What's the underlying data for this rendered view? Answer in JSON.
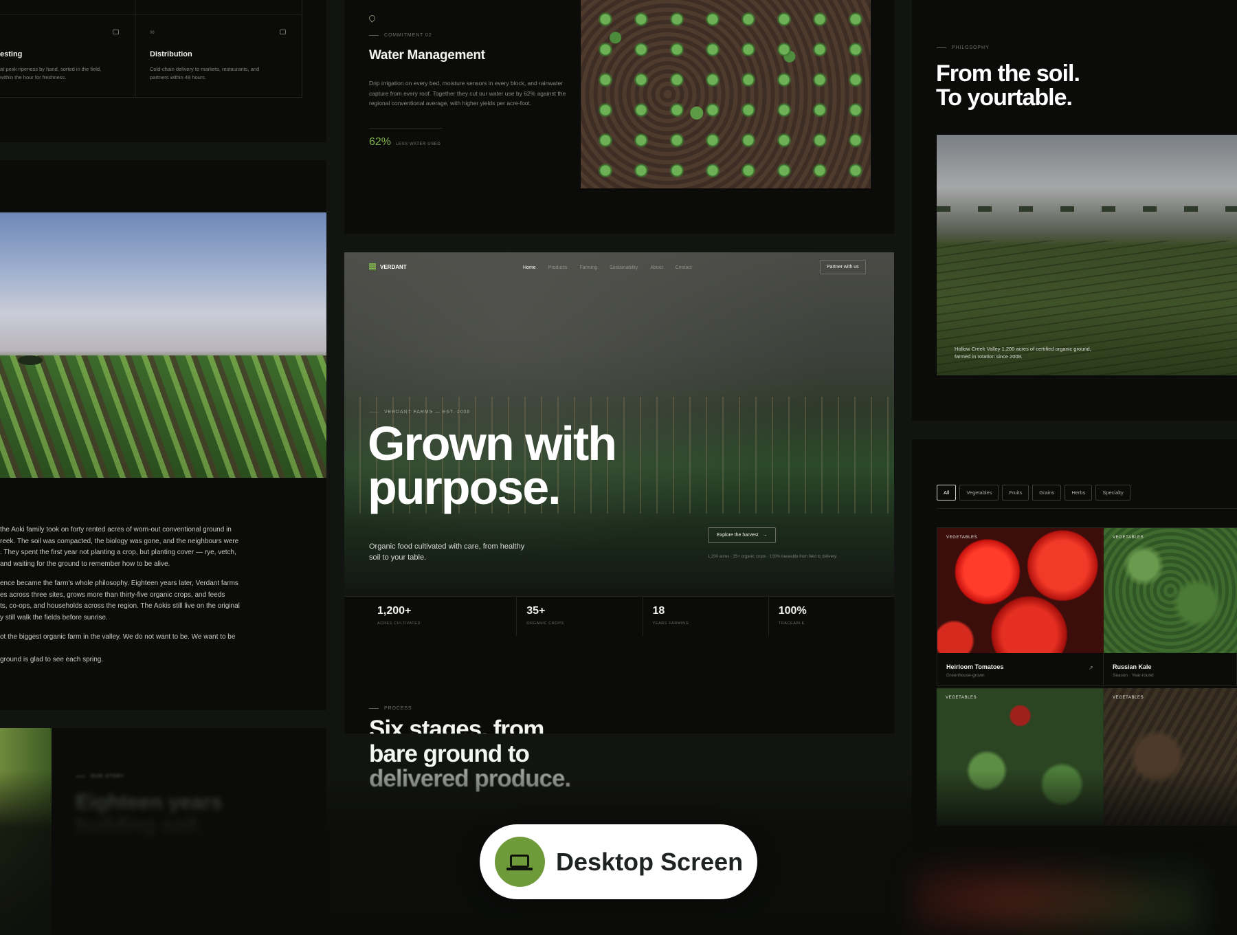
{
  "colors": {
    "accent": "#7fb24a",
    "badge_icon_bg": "#6f9a3a",
    "page_bg": "#121411",
    "panel_bg": "#0b0c0a"
  },
  "process_cards": {
    "card1": {
      "icon": "crate-icon",
      "title": "esting",
      "desc_1": "at peak ripeness by hand, sorted in the field,",
      "desc_2": "within the hour for freshness."
    },
    "card2": {
      "num": "06",
      "icon": "crate-icon",
      "title": "Distribution",
      "desc_1": "Cold-chain delivery to markets, restaurants, and",
      "desc_2": "partners within 48 hours."
    }
  },
  "commitment": {
    "icon": "water-drop-icon",
    "eyebrow": "COMMITMENT 02",
    "title": "Water Management",
    "body": "Drip irrigation on every bed, moisture sensors in every block, and rainwater capture from every roof. Together they cut our water use by 62% against the regional conventional average, with higher yields per acre-foot.",
    "stat_value": "62%",
    "stat_label": "LESS WATER USED"
  },
  "philosophy": {
    "eyebrow": "PHILOSOPHY",
    "title_line1": "From the soil.",
    "title_line2": "To yourtable.",
    "caption_line1": "Hollow Creek Valley 1,200 acres of certified organic ground,",
    "caption_line2": "farmed in rotation since 2008."
  },
  "story": {
    "p1": [
      "the Aoki family took on forty rented acres of worn-out conventional ground in",
      "reek. The soil was compacted, the biology was gone, and the neighbours were",
      ". They spent the first year not planting a crop, but planting cover — rye, vetch,",
      "and waiting for the ground to remember how to be alive."
    ],
    "p2": [
      "ence became the farm's whole philosophy. Eighteen years later, Verdant farms",
      "es across three sites, grows more than thirty-five organic crops, and feeds",
      "ts, co-ops, and households across the region. The Aokis still live on the original",
      "y still walk the fields before sunrise."
    ],
    "p3": "ot the biggest organic farm in the valley. We do not want to be. We want to be",
    "p4": "ground is glad to see each spring.",
    "bottom_eyebrow": "OUR STORY",
    "bottom_title_1": "Eighteen years",
    "bottom_title_2": "building soil."
  },
  "hero": {
    "brand": "VERDANT",
    "nav": [
      "Home",
      "Products",
      "Farming",
      "Sustainability",
      "About",
      "Contact"
    ],
    "cta": "Partner with us",
    "eyebrow": "VERDANT FARMS — EST. 2008",
    "headline_1": "Grown with",
    "headline_2": "purpose.",
    "subtitle_1": "Organic food cultivated with care, from healthy",
    "subtitle_2": "soil to your table.",
    "explore": "Explore the harvest",
    "note": "1,200 acres · 35+ organic crops · 100% traceable from field to delivery."
  },
  "stats": [
    {
      "value": "1,200+",
      "label": "ACRES CULTIVATED"
    },
    {
      "value": "35+",
      "label": "ORGANIC CROPS"
    },
    {
      "value": "18",
      "label": "YEARS FARMING"
    },
    {
      "value": "100%",
      "label": "TRACEABLE"
    }
  ],
  "process": {
    "eyebrow": "PROCESS",
    "title_1": "Six stages, from",
    "title_2": "bare ground to",
    "title_3": "delivered produce."
  },
  "products": {
    "filters": [
      "All",
      "Vegetables",
      "Fruits",
      "Grains",
      "Herbs",
      "Specialty"
    ],
    "items": [
      {
        "tag": "VEGETABLES",
        "name": "Heirloom Tomatoes",
        "meta": "Greenhouse-grown",
        "icon": "arrow-up-right-icon"
      },
      {
        "tag": "VEGETABLES",
        "name": "Russian Kale",
        "meta": "Season · Year-round"
      },
      {
        "tag": "VEGETABLES"
      },
      {
        "tag": "VEGETABLES"
      }
    ]
  },
  "badge": {
    "label": "Desktop Screen",
    "icon": "laptop-icon"
  }
}
